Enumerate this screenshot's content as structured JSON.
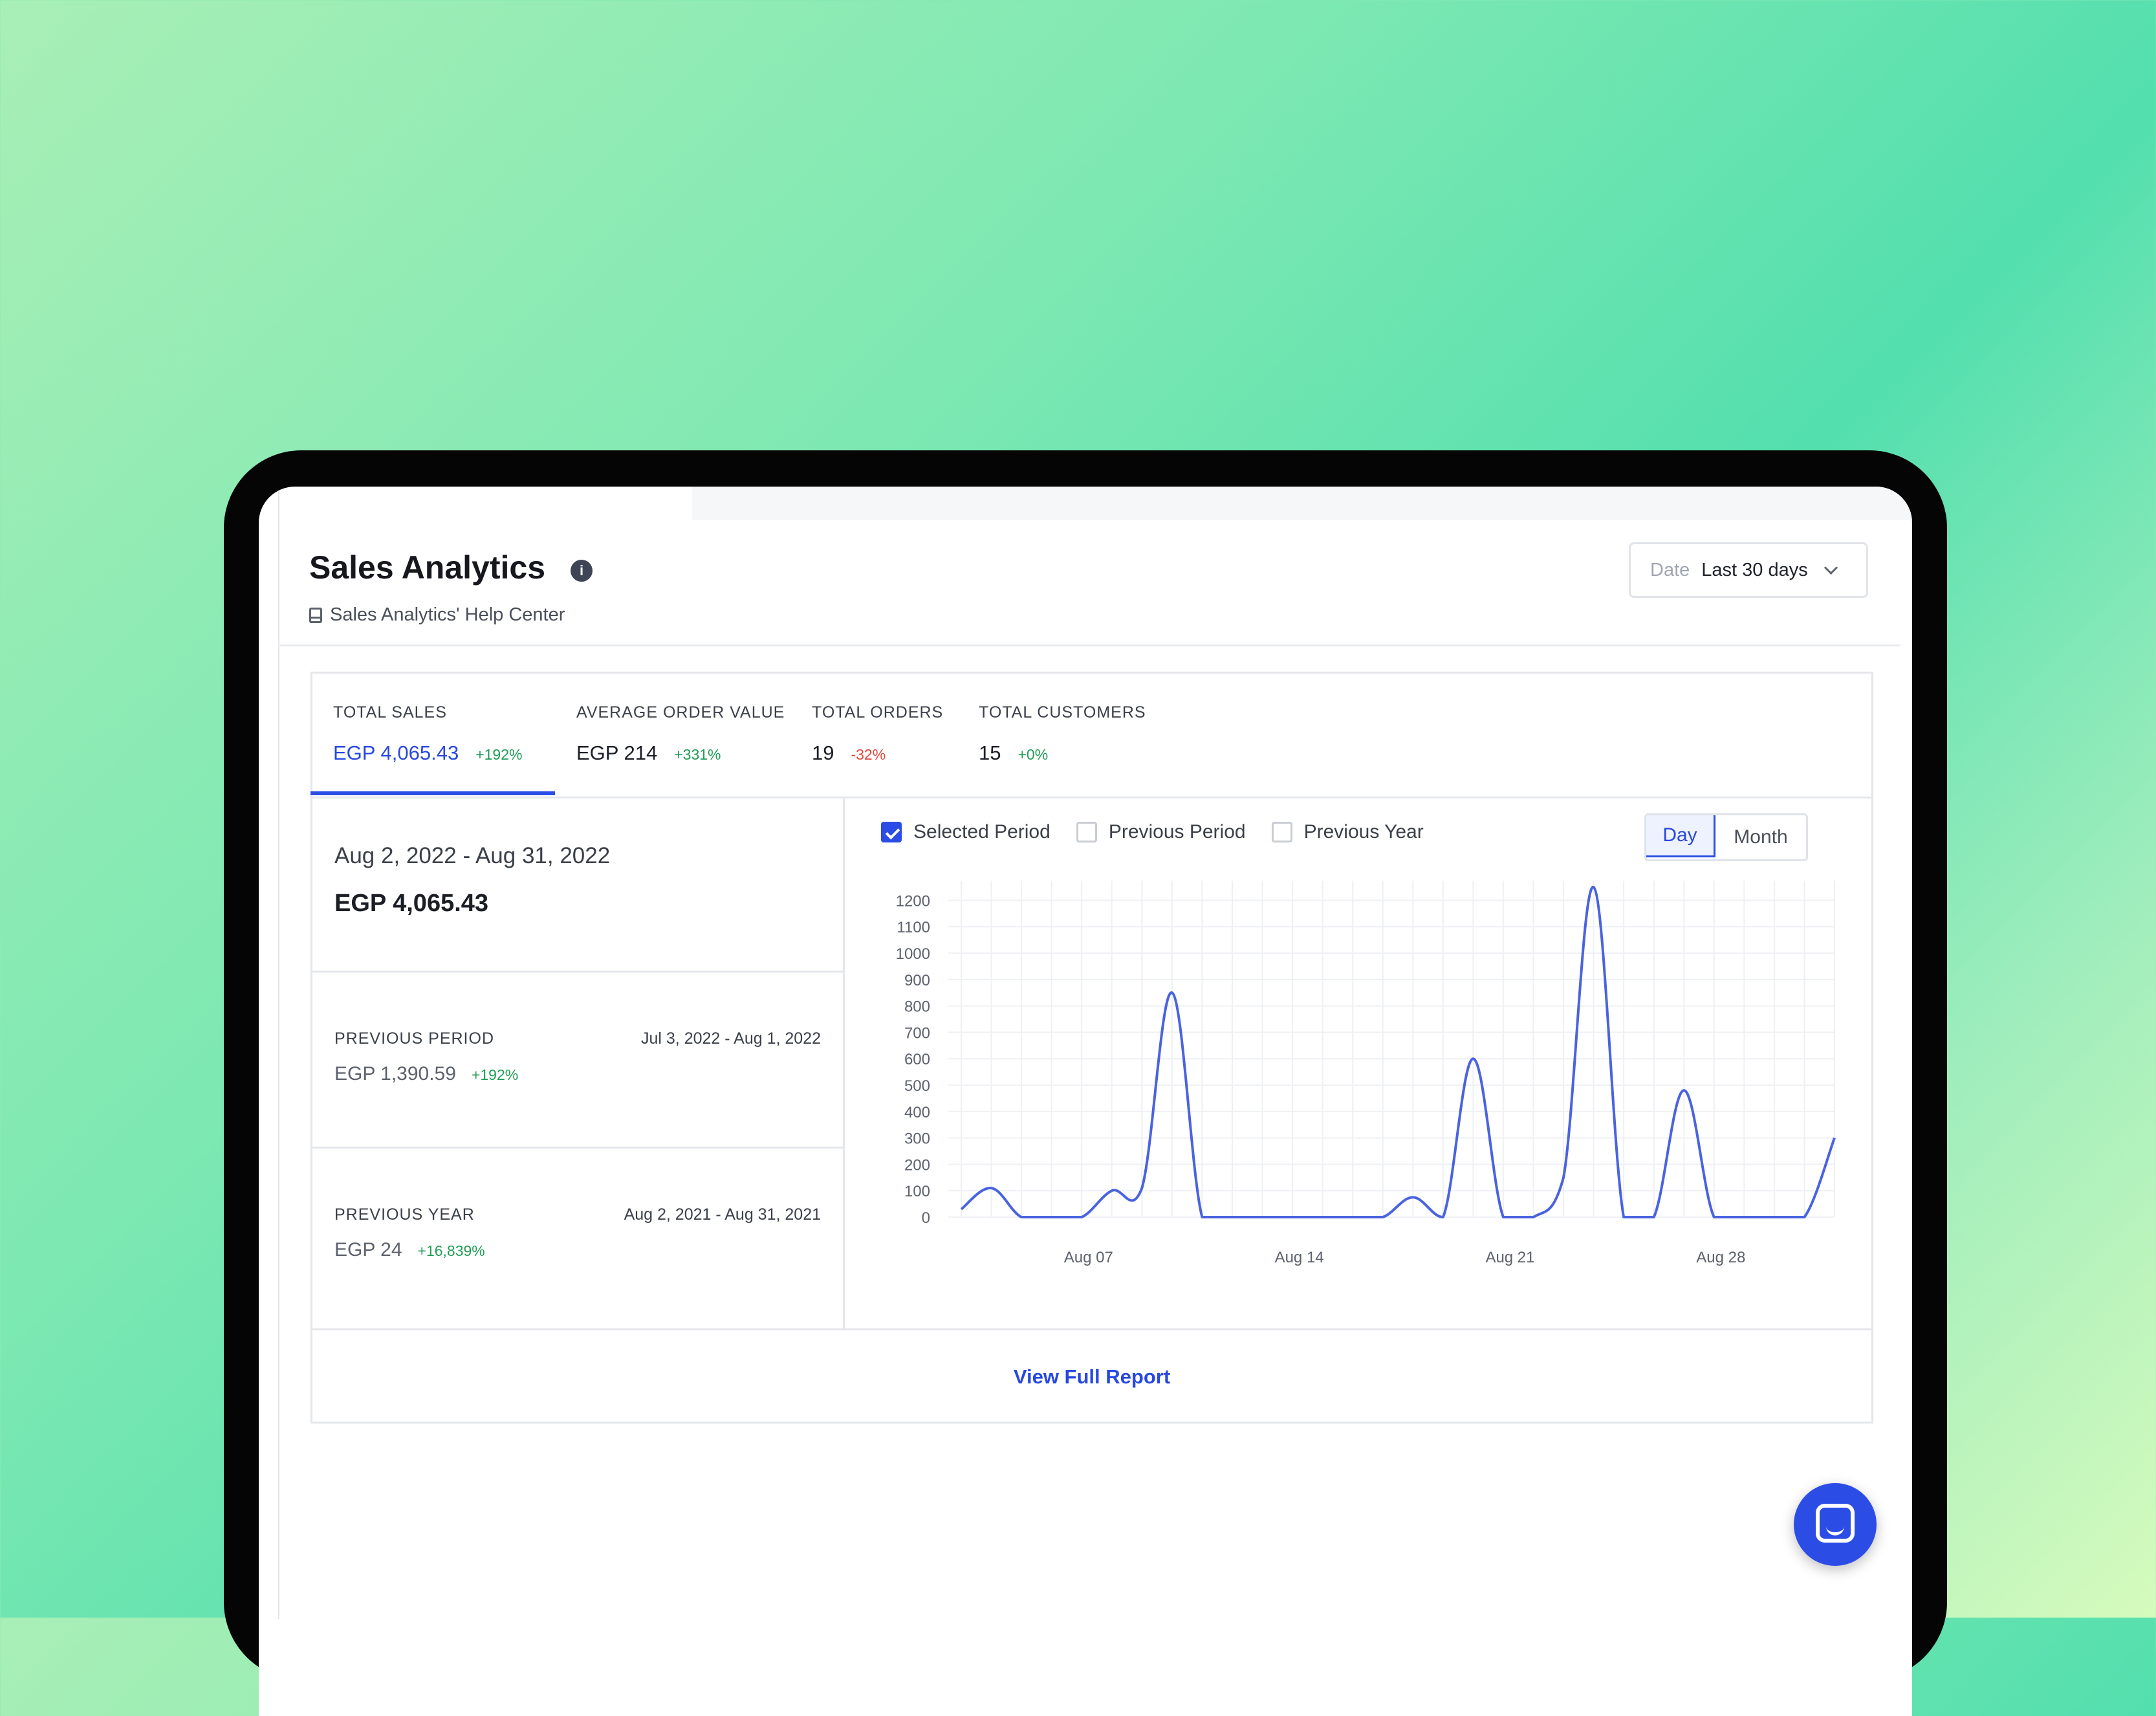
{
  "header": {
    "title": "Sales Analytics",
    "info_glyph": "i",
    "help_link": "Sales Analytics' Help Center"
  },
  "date_filter": {
    "label": "Date",
    "value": "Last 30 days"
  },
  "kpis": [
    {
      "label": "TOTAL SALES",
      "value": "EGP 4,065.43",
      "change": "+192%",
      "trend": "up"
    },
    {
      "label": "AVERAGE ORDER VALUE",
      "value": "EGP 214",
      "change": "+331%",
      "trend": "up"
    },
    {
      "label": "TOTAL ORDERS",
      "value": "19",
      "change": "-32%",
      "trend": "down"
    },
    {
      "label": "TOTAL CUSTOMERS",
      "value": "15",
      "change": "+0%",
      "trend": "up"
    }
  ],
  "summary": {
    "current": {
      "range": "Aug 2, 2022 - Aug 31, 2022",
      "amount": "EGP 4,065.43"
    },
    "previous_period": {
      "label": "PREVIOUS PERIOD",
      "range": "Jul 3, 2022 - Aug 1, 2022",
      "amount": "EGP 1,390.59",
      "change": "+192%"
    },
    "previous_year": {
      "label": "PREVIOUS YEAR",
      "range": "Aug 2, 2021 - Aug 31, 2021",
      "amount": "EGP 24",
      "change": "+16,839%"
    }
  },
  "legend": {
    "selected": "Selected Period",
    "previous_period": "Previous Period",
    "previous_year": "Previous Year"
  },
  "granularity": {
    "day": "Day",
    "month": "Month",
    "active": "Day"
  },
  "footer": {
    "link": "View Full Report"
  },
  "colors": {
    "accent": "#2b4de6",
    "line": "#4a63e0",
    "positive": "#1f9d55",
    "negative": "#e2463d"
  },
  "icons": {
    "info": "info-icon",
    "help": "book-icon",
    "chat": "chat-icon",
    "dropdown": "chevron-down-icon"
  },
  "chart_data": {
    "type": "line",
    "x": [
      "Aug 02",
      "Aug 03",
      "Aug 04",
      "Aug 05",
      "Aug 06",
      "Aug 07",
      "Aug 08",
      "Aug 09",
      "Aug 10",
      "Aug 11",
      "Aug 12",
      "Aug 13",
      "Aug 14",
      "Aug 15",
      "Aug 16",
      "Aug 17",
      "Aug 18",
      "Aug 19",
      "Aug 20",
      "Aug 21",
      "Aug 22",
      "Aug 23",
      "Aug 24",
      "Aug 25",
      "Aug 26",
      "Aug 27",
      "Aug 28",
      "Aug 29",
      "Aug 30",
      "Aug 31"
    ],
    "series": [
      {
        "values": [
          30,
          110,
          0,
          0,
          0,
          100,
          110,
          850,
          0,
          0,
          0,
          0,
          0,
          0,
          0,
          75,
          0,
          600,
          0,
          0,
          150,
          1250,
          0,
          0,
          480,
          0,
          0,
          0,
          0,
          300
        ]
      }
    ],
    "x_ticks": [
      "Aug 07",
      "Aug 14",
      "Aug 21",
      "Aug 28"
    ],
    "y_ticks": [
      0,
      100,
      200,
      300,
      400,
      500,
      600,
      700,
      800,
      900,
      1000,
      1100,
      1200
    ],
    "ylim": [
      0,
      1250
    ],
    "grid": true,
    "legend": "top-left"
  }
}
